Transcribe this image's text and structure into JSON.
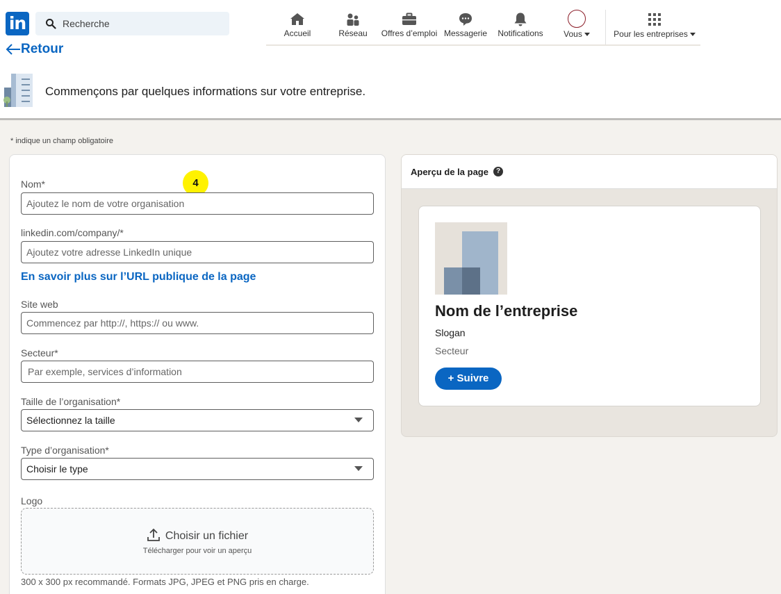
{
  "nav": {
    "logo": "in",
    "search_placeholder": "Recherche",
    "items": [
      {
        "label": "Accueil",
        "icon": "home-icon"
      },
      {
        "label": "Réseau",
        "icon": "people-icon"
      },
      {
        "label": "Offres d’emploi",
        "icon": "briefcase-icon"
      },
      {
        "label": "Messagerie",
        "icon": "chat-icon"
      },
      {
        "label": "Notifications",
        "icon": "bell-icon"
      },
      {
        "label": "Vous",
        "icon": "avatar"
      },
      {
        "label": "Pour les entreprises",
        "icon": "grid-icon"
      }
    ]
  },
  "header": {
    "back_label": "Retour",
    "intro": "Commençons par quelques informations sur votre entreprise."
  },
  "form": {
    "required_note": "*  indique un champ obligatoire",
    "badge": "4",
    "name_label": "Nom*",
    "name_placeholder": "Ajoutez le nom de votre organisation",
    "url_label": "linkedin.com/company/*",
    "url_placeholder": "Ajoutez votre adresse LinkedIn unique",
    "learn_more": "En savoir plus sur l’URL publique de la page",
    "website_label": "Site web",
    "website_placeholder": "Commencez par http://, https:// ou www.",
    "sector_label": "Secteur*",
    "sector_placeholder": "Par exemple, services d’information",
    "size_label": "Taille de l’organisation*",
    "size_value": "Sélectionnez la taille",
    "type_label": "Type d’organisation*",
    "type_value": "Choisir le type",
    "logo_label": "Logo",
    "upload_label": "Choisir un fichier",
    "upload_sub": "Télécharger pour voir un aperçu",
    "upload_hint": "300 x 300 px recommandé. Formats JPG, JPEG et PNG pris en charge."
  },
  "preview": {
    "title": "Aperçu de la page",
    "help": "?",
    "company_name": "Nom de l’entreprise",
    "slogan": "Slogan",
    "sector": "Secteur",
    "follow": "+ Suivre"
  },
  "colors": {
    "accent": "#0a66c2",
    "badge": "#fff200"
  }
}
